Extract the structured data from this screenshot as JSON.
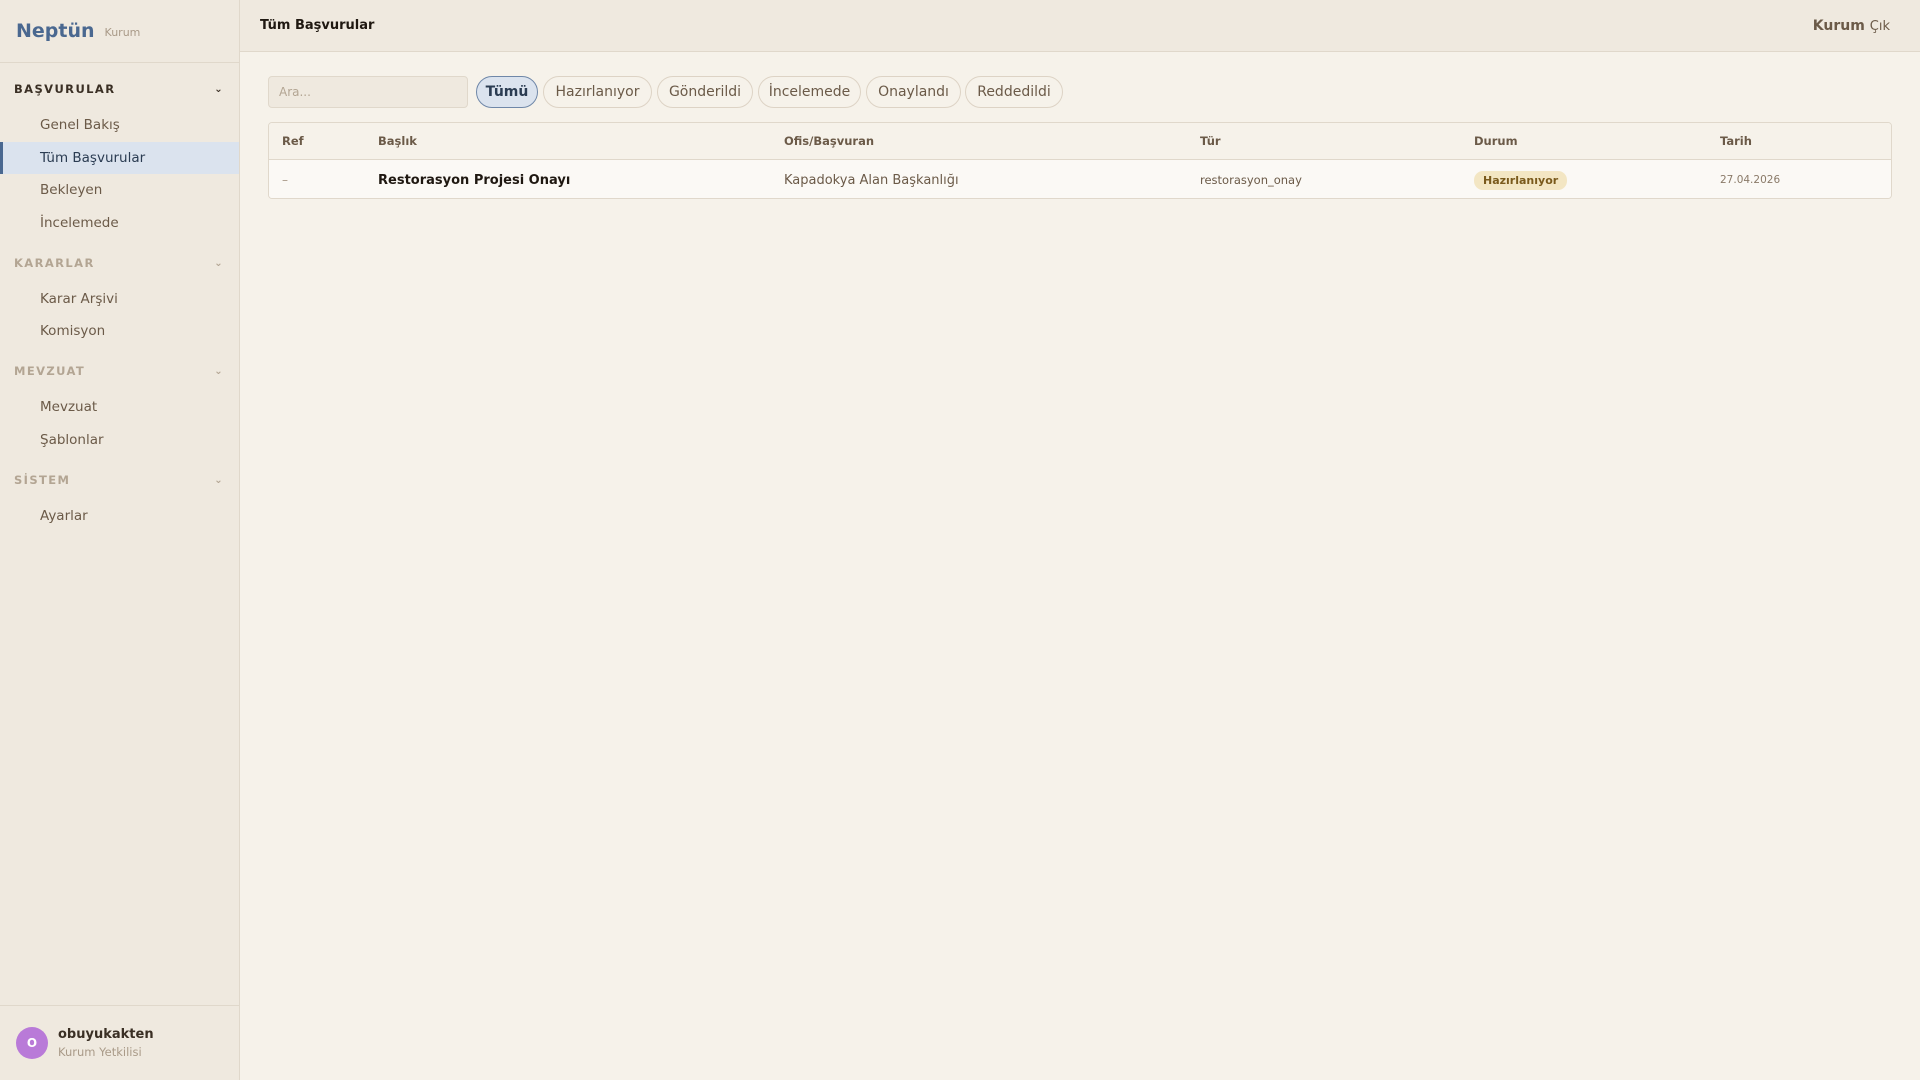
{
  "brand": {
    "name": "Neptün",
    "sub": "Kurum"
  },
  "sidebar": {
    "sections": [
      {
        "label": "BAŞVURULAR",
        "chevron": "⌄",
        "items": [
          {
            "label": "Genel Bakış"
          },
          {
            "label": "Tüm Başvurular"
          },
          {
            "label": "Bekleyen"
          },
          {
            "label": "İncelemede"
          }
        ]
      },
      {
        "label": "KARARLAR",
        "chevron": "⌄",
        "items": [
          {
            "label": "Karar Arşivi"
          },
          {
            "label": "Komisyon"
          }
        ]
      },
      {
        "label": "MEVZUAT",
        "chevron": "⌄",
        "items": [
          {
            "label": "Mevzuat"
          },
          {
            "label": "Şablonlar"
          }
        ]
      },
      {
        "label": "SİSTEM",
        "chevron": "⌄",
        "items": [
          {
            "label": "Ayarlar"
          }
        ]
      }
    ],
    "selected": "Tüm Başvurular"
  },
  "user": {
    "initial": "O",
    "name": "obuyukakten",
    "role": "Kurum Yetkilisi",
    "avatar_color": "#b97ad8"
  },
  "header": {
    "title": "Tüm Başvurular",
    "org": "Kurum",
    "logout": "Çık"
  },
  "search": {
    "placeholder": "Ara...",
    "value": ""
  },
  "filters": [
    {
      "label": "Tümü",
      "active": true
    },
    {
      "label": "Hazırlanıyor",
      "active": false
    },
    {
      "label": "Gönderildi",
      "active": false
    },
    {
      "label": "İncelemede",
      "active": false
    },
    {
      "label": "Onaylandı",
      "active": false
    },
    {
      "label": "Reddedildi",
      "active": false
    }
  ],
  "table": {
    "columns": [
      "Ref",
      "Başlık",
      "Ofis/Başvuran",
      "Tür",
      "Durum",
      "Tarih"
    ],
    "rows": [
      {
        "ref": "–",
        "title": "Restorasyon Projesi Onayı",
        "applicant": "Kapadokya Alan Başkanlığı",
        "type": "restorasyon_onay",
        "status": "Hazırlanıyor",
        "date": "27.04.2026"
      }
    ]
  },
  "colors": {
    "accent": "#4a6890",
    "selected_bg": "#dbe3ee",
    "status_pending_bg": "#f3e6c3"
  }
}
